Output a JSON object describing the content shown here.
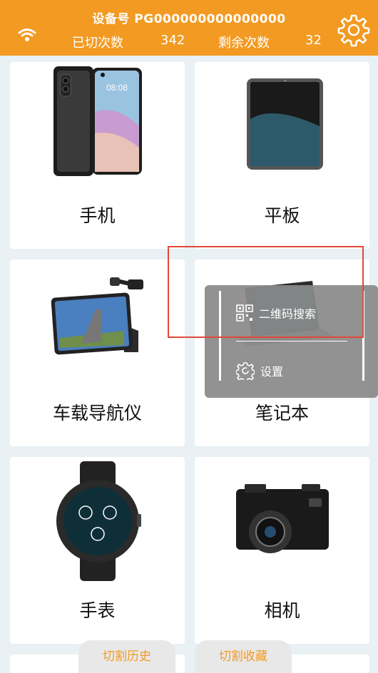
{
  "header": {
    "device_id": "设备号 PG000000000000000",
    "cut_count_label": "已切次数",
    "cut_count_value": "342",
    "remaining_label": "剩余次数",
    "remaining_value": "32",
    "background_color": "#f39a22"
  },
  "categories": [
    {
      "label": "手机",
      "icon": "phone-icon"
    },
    {
      "label": "平板",
      "icon": "tablet-icon"
    },
    {
      "label": "车载导航仪",
      "icon": "car-navigator-icon"
    },
    {
      "label": "笔记本",
      "icon": "laptop-icon"
    },
    {
      "label": "手表",
      "icon": "watch-icon"
    },
    {
      "label": "相机",
      "icon": "camera-icon"
    }
  ],
  "popup_menu": {
    "qr_search_label": "二维码搜索",
    "settings_label": "设置"
  },
  "bottom_tabs": {
    "history_label": "切割历史",
    "favorites_label": "切割收藏"
  },
  "colors": {
    "accent": "#f39a22",
    "highlight_border": "#e2483a"
  }
}
